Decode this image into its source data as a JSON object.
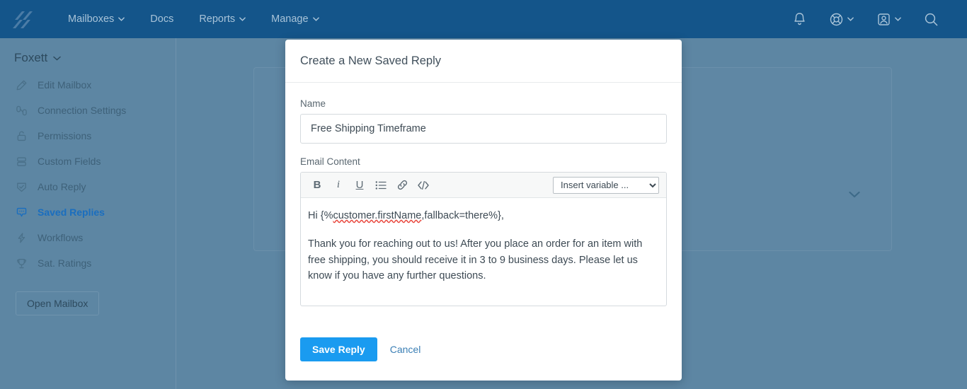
{
  "colors": {
    "nav_bg": "#14558a",
    "sidebar_bg": "#5d86a3",
    "accent_blue": "#1a9bf0",
    "active_item": "#1a6ebf",
    "link": "#3b7fb5"
  },
  "topnav": {
    "logo": "helpscout-logo",
    "links": [
      {
        "label": "Mailboxes",
        "has_caret": true
      },
      {
        "label": "Docs",
        "has_caret": false
      },
      {
        "label": "Reports",
        "has_caret": true
      },
      {
        "label": "Manage",
        "has_caret": true
      }
    ],
    "right_icons": [
      {
        "name": "notifications-bell-icon",
        "has_caret": false
      },
      {
        "name": "help-lifebuoy-icon",
        "has_caret": true
      },
      {
        "name": "account-avatar-icon",
        "has_caret": true
      },
      {
        "name": "search-icon",
        "has_caret": false
      }
    ]
  },
  "sidebar": {
    "mailbox_name": "Foxett",
    "items": [
      {
        "label": "Edit Mailbox",
        "icon": "pencil-icon",
        "active": false
      },
      {
        "label": "Connection Settings",
        "icon": "connection-icon",
        "active": false
      },
      {
        "label": "Permissions",
        "icon": "lock-icon",
        "active": false
      },
      {
        "label": "Custom Fields",
        "icon": "fields-icon",
        "active": false
      },
      {
        "label": "Auto Reply",
        "icon": "shield-check-icon",
        "active": false
      },
      {
        "label": "Saved Replies",
        "icon": "speech-bubble-icon",
        "active": true
      },
      {
        "label": "Workflows",
        "icon": "lightning-icon",
        "active": false
      },
      {
        "label": "Sat. Ratings",
        "icon": "trophy-icon",
        "active": false
      }
    ],
    "open_mailbox_label": "Open Mailbox"
  },
  "modal": {
    "title": "Create a New Saved Reply",
    "name_field": {
      "label": "Name",
      "value": "Free Shipping Timeframe",
      "placeholder": ""
    },
    "email_content": {
      "label": "Email Content",
      "toolbar": [
        {
          "name": "bold-icon",
          "glyph": "B"
        },
        {
          "name": "italic-icon",
          "glyph": "i"
        },
        {
          "name": "underline-icon",
          "glyph": "U"
        },
        {
          "name": "bullet-list-icon",
          "glyph": ""
        },
        {
          "name": "link-icon",
          "glyph": ""
        },
        {
          "name": "code-icon",
          "glyph": ""
        }
      ],
      "insert_variable": {
        "selected": "Insert variable ...",
        "options": [
          "Insert variable ..."
        ]
      },
      "body": {
        "greeting_prefix": "Hi {%",
        "greeting_variable": "customer.firstName",
        "greeting_suffix": ",fallback=there%},",
        "paragraph": "Thank you for reaching out to us! After you place an order for an item with free shipping, you should receive it in 3 to 9 business days. Please let us know if you have any further questions."
      }
    },
    "save_label": "Save Reply",
    "cancel_label": "Cancel"
  }
}
